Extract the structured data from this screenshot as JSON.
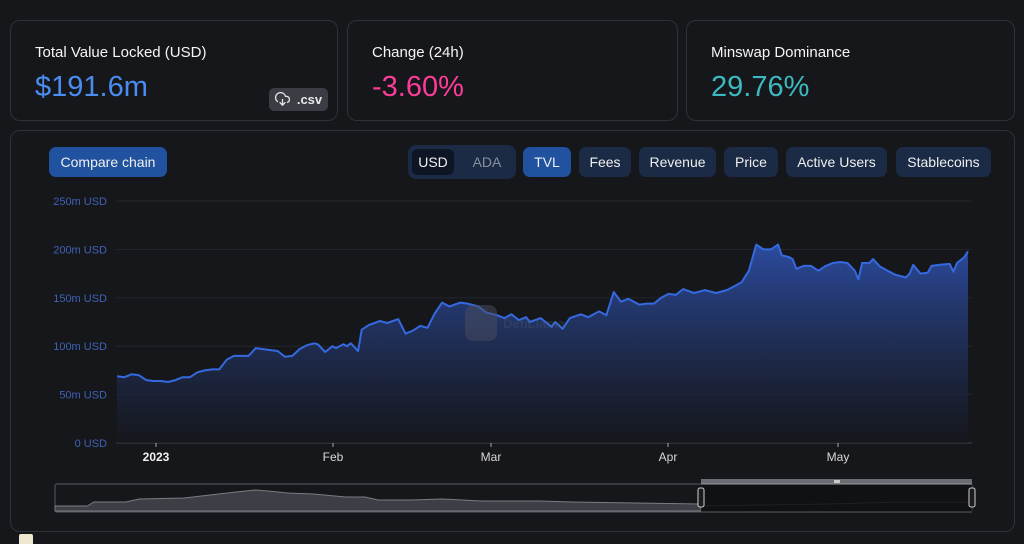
{
  "stats": {
    "tvl": {
      "label": "Total Value Locked (USD)",
      "value": "$191.6m",
      "color": "#4a8cf0",
      "csv_label": ".csv",
      "csv_icon": "cloud-download-icon"
    },
    "change": {
      "label": "Change (24h)",
      "value": "-3.60%",
      "color": "#fd3c99"
    },
    "dominance": {
      "label": "Minswap Dominance",
      "value": "29.76%",
      "color": "#3db8c0"
    }
  },
  "toolbar": {
    "compare_label": "Compare chain",
    "units": [
      {
        "label": "USD",
        "selected": true
      },
      {
        "label": "ADA",
        "selected": false
      }
    ],
    "metrics": [
      {
        "label": "TVL",
        "selected": true
      },
      {
        "label": "Fees",
        "selected": false
      },
      {
        "label": "Revenue",
        "selected": false
      },
      {
        "label": "Price",
        "selected": false
      },
      {
        "label": "Active Users",
        "selected": false
      },
      {
        "label": "Stablecoins",
        "selected": false
      }
    ]
  },
  "watermark": "DefiLlama",
  "accent_color": "#2f6ae0",
  "chart_data": {
    "type": "area",
    "title": "",
    "xlabel": "",
    "ylabel": "",
    "series": [
      {
        "name": "TVL (USD)",
        "unit": "m USD",
        "points": [
          [
            0,
            69
          ],
          [
            2,
            68
          ],
          [
            4,
            71
          ],
          [
            6,
            70
          ],
          [
            8,
            65
          ],
          [
            10,
            64
          ],
          [
            12,
            64
          ],
          [
            14,
            63
          ],
          [
            16,
            65
          ],
          [
            18,
            68
          ],
          [
            20,
            68
          ],
          [
            22,
            73
          ],
          [
            24,
            75
          ],
          [
            26,
            76
          ],
          [
            28,
            76
          ],
          [
            30,
            86
          ],
          [
            32,
            90
          ],
          [
            34,
            90
          ],
          [
            36,
            90
          ],
          [
            38,
            98
          ],
          [
            40,
            97
          ],
          [
            42,
            96
          ],
          [
            44,
            95
          ],
          [
            46,
            89
          ],
          [
            48,
            90
          ],
          [
            50,
            97
          ],
          [
            52,
            101
          ],
          [
            54,
            103
          ],
          [
            55,
            102
          ],
          [
            57,
            94
          ],
          [
            59,
            100
          ],
          [
            60,
            98
          ],
          [
            62,
            102
          ],
          [
            63,
            100
          ],
          [
            64,
            103
          ],
          [
            66,
            95
          ],
          [
            67,
            117
          ],
          [
            69,
            122
          ],
          [
            72,
            126
          ],
          [
            74,
            124
          ],
          [
            77,
            128
          ],
          [
            79,
            113
          ],
          [
            81,
            116
          ],
          [
            83,
            121
          ],
          [
            85,
            119
          ],
          [
            87,
            134
          ],
          [
            89,
            145
          ],
          [
            91,
            141
          ],
          [
            94,
            145
          ],
          [
            96,
            144
          ],
          [
            99,
            141
          ],
          [
            101,
            135
          ],
          [
            104,
            132
          ],
          [
            106,
            129
          ],
          [
            108,
            133
          ],
          [
            110,
            127
          ],
          [
            112,
            130
          ],
          [
            113,
            125
          ],
          [
            116,
            129
          ],
          [
            119,
            120
          ],
          [
            120,
            125
          ],
          [
            122,
            118
          ],
          [
            124,
            129
          ],
          [
            127,
            133
          ],
          [
            129,
            130
          ],
          [
            131,
            134
          ],
          [
            132,
            136
          ],
          [
            134,
            132
          ],
          [
            136,
            156
          ],
          [
            138,
            146
          ],
          [
            140,
            149
          ],
          [
            143,
            143
          ],
          [
            145,
            144
          ],
          [
            147,
            144
          ],
          [
            149,
            150
          ],
          [
            151,
            154
          ],
          [
            153,
            153
          ],
          [
            155,
            159
          ],
          [
            158,
            155
          ],
          [
            161,
            158
          ],
          [
            164,
            155
          ],
          [
            167,
            158
          ],
          [
            169,
            162
          ],
          [
            171,
            166
          ],
          [
            172,
            172
          ],
          [
            173,
            178
          ],
          [
            175,
            205
          ],
          [
            177,
            200
          ],
          [
            179,
            200
          ],
          [
            181,
            205
          ],
          [
            182,
            194
          ],
          [
            184,
            192
          ],
          [
            185,
            190
          ],
          [
            186,
            180
          ],
          [
            188,
            183
          ],
          [
            190,
            183
          ],
          [
            192,
            178
          ],
          [
            194,
            183
          ],
          [
            196,
            186
          ],
          [
            198,
            187
          ],
          [
            200,
            186
          ],
          [
            201,
            182
          ],
          [
            202,
            178
          ],
          [
            203,
            169
          ],
          [
            204,
            186
          ],
          [
            206,
            186
          ],
          [
            207,
            190
          ],
          [
            209,
            182
          ],
          [
            211,
            178
          ],
          [
            213,
            174
          ],
          [
            216,
            171
          ],
          [
            217,
            175
          ],
          [
            218,
            184
          ],
          [
            220,
            175
          ],
          [
            222,
            176
          ],
          [
            223,
            183
          ],
          [
            225,
            184
          ],
          [
            228,
            185
          ],
          [
            229,
            177
          ],
          [
            230,
            186
          ],
          [
            232,
            192
          ],
          [
            233,
            198
          ]
        ]
      }
    ],
    "x_axis": {
      "start_date": "2022-12-24",
      "ticks": [
        {
          "label": "2023",
          "day": 8,
          "bold": true
        },
        {
          "label": "Feb",
          "day": 39
        },
        {
          "label": "Mar",
          "day": 67
        },
        {
          "label": "Apr",
          "day": 98
        },
        {
          "label": "May",
          "day": 128
        }
      ],
      "range": [
        0,
        150
      ]
    },
    "y_axis": {
      "ticks": [
        "0 USD",
        "50m USD",
        "100m USD",
        "150m USD",
        "200m USD",
        "250m USD"
      ],
      "tick_values": [
        0,
        50,
        100,
        150,
        200,
        250
      ],
      "range": [
        0,
        250
      ]
    },
    "grid": true,
    "legend": "none",
    "overview_slider": {
      "selected_range_fraction": [
        0.75,
        1.0
      ],
      "overview_series_desc": "full history TVL (shown in gray, with peak around the early part)"
    }
  }
}
